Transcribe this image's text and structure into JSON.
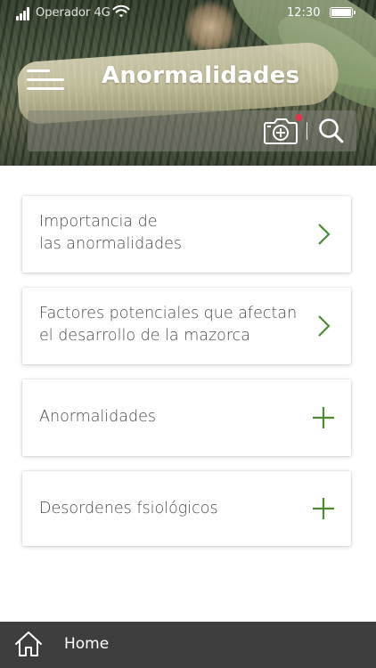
{
  "status_bar": {
    "carrier": "Operador 4G",
    "time": "12:30"
  },
  "header": {
    "title": "Anormalidades",
    "menu_icon": "hamburger-menu-icon"
  },
  "search": {
    "placeholder": "",
    "value": "",
    "camera_icon": "camera-scan-icon",
    "search_icon": "search-icon",
    "notification_color": "#e0344b"
  },
  "cards": [
    {
      "label": "Importancia de\nlas anormalidades",
      "action_icon": "chevron-right-icon"
    },
    {
      "label": "Factores potenciales que afectan\nel desarrollo de la mazorca",
      "action_icon": "chevron-right-icon"
    },
    {
      "label": "Anormalidades",
      "action_icon": "plus-icon"
    },
    {
      "label": "Desordenes fsiológicos",
      "action_icon": "plus-icon"
    }
  ],
  "bottom_nav": {
    "home_label": "Home",
    "home_icon": "home-icon"
  },
  "colors": {
    "accent_green": "#4e8a34",
    "bottom_bar": "#3e3e3e",
    "card_text": "#4a4a4a"
  }
}
